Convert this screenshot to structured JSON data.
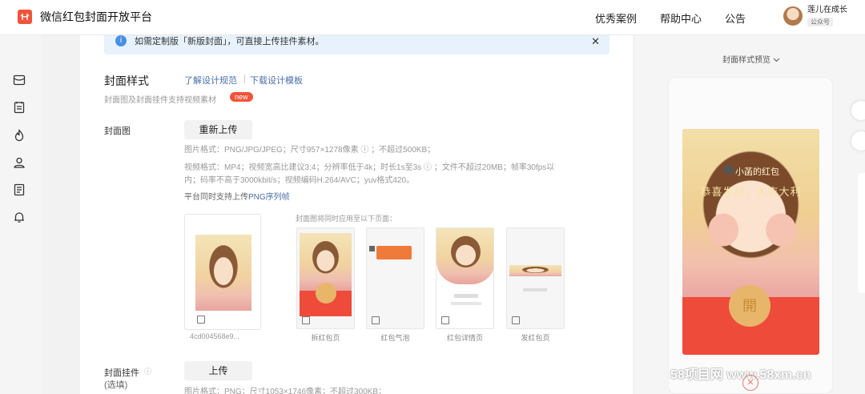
{
  "header": {
    "title": "微信红包封面开放平台",
    "nav": [
      "优秀案例",
      "帮助中心",
      "公告"
    ],
    "user": {
      "name": "莲儿在成长",
      "type": "公众号"
    }
  },
  "rail": {
    "icons": [
      "red-packet-icon",
      "list-icon",
      "fire-icon",
      "users-icon",
      "document-icon",
      "bell-icon"
    ]
  },
  "notice": {
    "text": "如需定制版「新版封面」，可直接上传挂件素材。",
    "close": "✕"
  },
  "section": {
    "title": "封面样式",
    "link_spec": "了解设计规范",
    "link_download": "下载设计模板",
    "subtitle": "封面图及封面挂件支持视频素材",
    "badge": "new"
  },
  "cover_image": {
    "label": "封面图",
    "button": "重新上传",
    "spec_image": "图片格式：PNG/JPG/JPEG；尺寸957×1278像素 ⓘ ；不超过500KB；",
    "spec_video_1": "视频格式：MP4；视频宽高比建议3:4；分辨率低于4k；时长1s至3s ⓘ ；文件不超过20MB；帧率30fps以",
    "spec_video_2": "内；码率不高于3000kbit/s；视频编码H.264/AVC；yuv格式420。",
    "spec_png_prefix": "平台同时支持上传",
    "spec_png_link": "PNG序列帧",
    "file_name": "4cd004568e9...",
    "apply_hint": "封面图将同时应用至以下页面：",
    "pages": [
      "拆红包页",
      "红包气泡",
      "红包详情页",
      "发红包页"
    ]
  },
  "pendant": {
    "label": "封面挂件",
    "optional": "(选填)",
    "button": "上传",
    "spec": "图片格式：PNG；尺寸1053×1746像素；不超过300KB；"
  },
  "preview": {
    "title": "封面样式预览",
    "tag": "小菡的红包",
    "blessing": "恭喜发财，大吉大利",
    "open": "開"
  },
  "watermark": {
    "text": "58项目网 www.58xm.cn",
    "circle": "✕"
  }
}
